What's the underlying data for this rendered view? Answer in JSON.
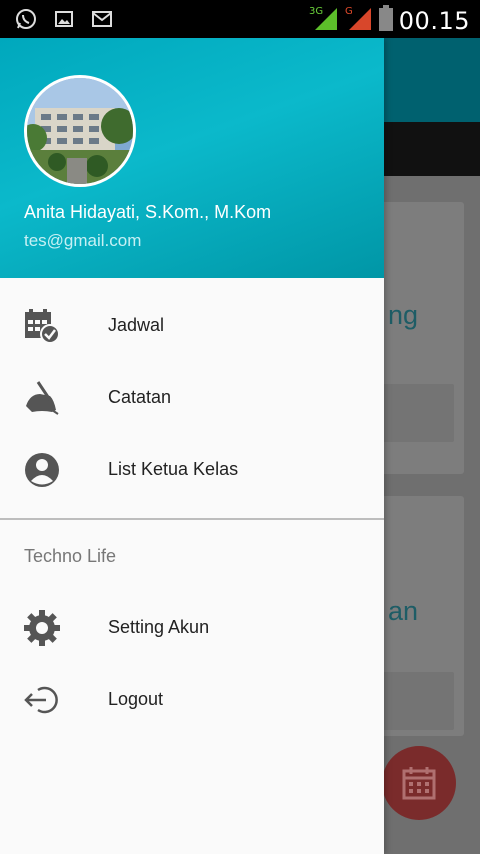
{
  "status_bar": {
    "time": "00.15",
    "left_icons": [
      "whatsapp-icon",
      "image-icon",
      "gmail-icon"
    ],
    "network_3g_label": "3G",
    "network_g_label": "G"
  },
  "drawer": {
    "header": {
      "name": "Anita Hidayati, S.Kom., M.Kom",
      "email": "tes@gmail.com"
    },
    "items": [
      {
        "label": "Jadwal",
        "icon": "calendar-check-icon"
      },
      {
        "label": "Catatan",
        "icon": "hand-writing-icon"
      },
      {
        "label": "List Ketua Kelas",
        "icon": "account-circle-icon"
      }
    ],
    "section_title": "Techno Life",
    "section_items": [
      {
        "label": "Setting Akun",
        "icon": "gear-icon"
      },
      {
        "label": "Logout",
        "icon": "logout-icon"
      }
    ]
  },
  "background_app": {
    "card1_text_fragment": "ng",
    "card2_text_fragment": "an"
  },
  "colors": {
    "header": "#00a8bd",
    "scrim": "#7a7a7a",
    "fab": "#e53935"
  }
}
